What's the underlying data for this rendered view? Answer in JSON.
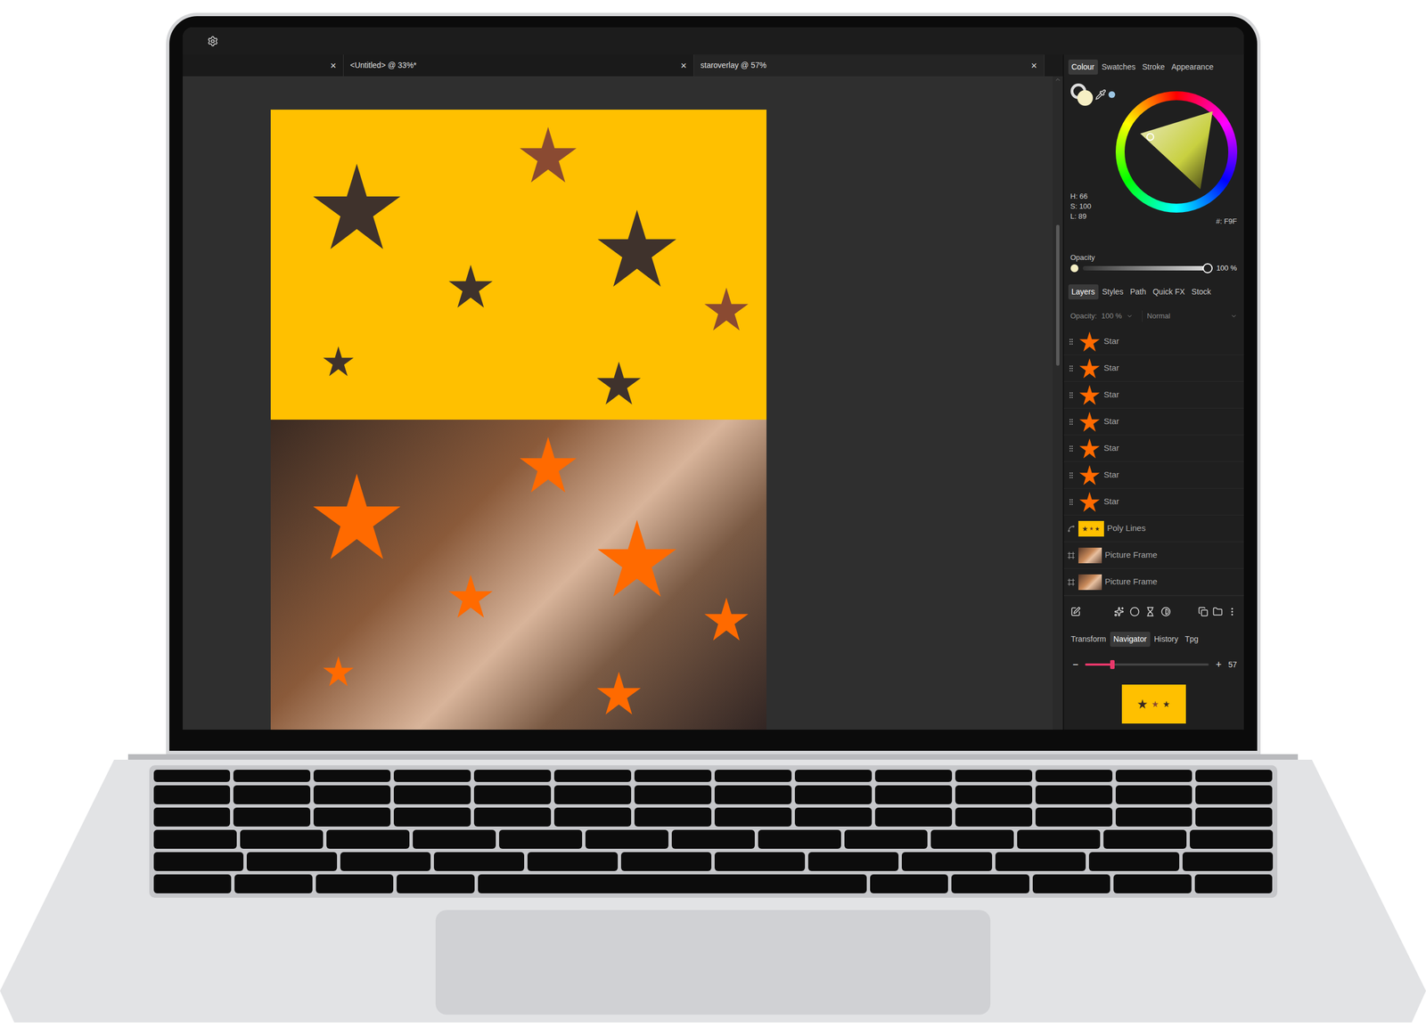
{
  "document_tabs": [
    {
      "label": "",
      "close": "×",
      "selected": false
    },
    {
      "label": "<Untitled> @ 33%*",
      "close": "×",
      "selected": false
    },
    {
      "label": "staroverlay @ 57%",
      "close": "×",
      "selected": true
    }
  ],
  "colour_panel": {
    "tabs": [
      {
        "label": "Colour",
        "selected": true
      },
      {
        "label": "Swatches",
        "selected": false
      },
      {
        "label": "Stroke",
        "selected": false
      },
      {
        "label": "Appearance",
        "selected": false
      }
    ],
    "h": "H: 66",
    "s": "S: 100",
    "l": "L: 89",
    "hex": "#: F9F",
    "opacity_label": "Opacity",
    "opacity_value": "100 %",
    "opacity_level": 1
  },
  "layers_panel": {
    "tabs": [
      {
        "label": "Layers",
        "selected": true
      },
      {
        "label": "Styles",
        "selected": false
      },
      {
        "label": "Path",
        "selected": false
      },
      {
        "label": "Quick FX",
        "selected": false
      },
      {
        "label": "Stock",
        "selected": false
      }
    ],
    "opacity_label": "Opacity:",
    "opacity_value": "100 %",
    "blend_mode": "Normal",
    "layers": [
      {
        "name": "Star",
        "kind": "star",
        "selected": false
      },
      {
        "name": "Star",
        "kind": "star",
        "selected": false
      },
      {
        "name": "Star",
        "kind": "star",
        "selected": false
      },
      {
        "name": "Star",
        "kind": "star",
        "selected": false
      },
      {
        "name": "Star",
        "kind": "star",
        "selected": false
      },
      {
        "name": "Star",
        "kind": "star",
        "selected": false
      },
      {
        "name": "Star",
        "kind": "star",
        "selected": false
      },
      {
        "name": "Poly Lines",
        "kind": "poly",
        "selected": false
      },
      {
        "name": "Picture Frame",
        "kind": "frame",
        "selected": false
      },
      {
        "name": "Picture Frame",
        "kind": "frame",
        "selected": false
      }
    ]
  },
  "navigator_panel": {
    "tabs": [
      {
        "label": "Transform",
        "selected": false
      },
      {
        "label": "Navigator",
        "selected": true
      },
      {
        "label": "History",
        "selected": false
      },
      {
        "label": "Tpg",
        "selected": false
      }
    ],
    "zoom_out": "−",
    "zoom_in": "+",
    "zoom_level": 0.22,
    "zoom_value": "57"
  }
}
